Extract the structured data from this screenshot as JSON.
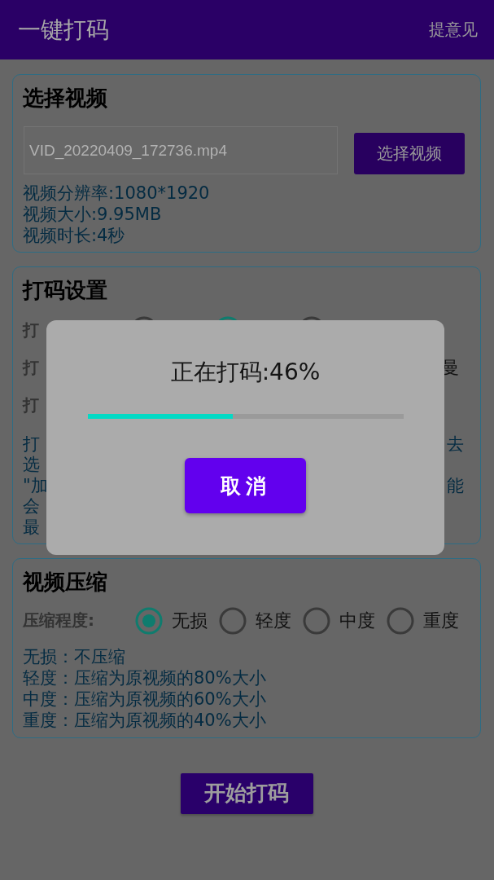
{
  "app_bar": {
    "title": "一键打码",
    "action": "提意见"
  },
  "video_card": {
    "title": "选择视频",
    "file_field": {
      "placeholder": "VID_20220409_172736.mp4"
    },
    "button": "选择视频",
    "info": [
      "视频分辨率:1080*1920",
      "视频大小:9.95MB",
      "视频时长:4秒"
    ]
  },
  "mosaic_card": {
    "title": "打码设置",
    "rows": [
      {
        "label": "打",
        "options": [
          {
            "selected": false
          },
          {
            "selected": true
          },
          {
            "selected": false
          }
        ]
      },
      {
        "label": "打",
        "end": "曼"
      },
      {
        "label": "打"
      }
    ],
    "notes": [
      {
        "start": "打",
        "end": "去"
      },
      {
        "start": "选"
      },
      {
        "start": "\"加",
        "end": "能"
      },
      {
        "start": "会"
      },
      {
        "start": "最"
      }
    ]
  },
  "compression_card": {
    "title": "视频压缩",
    "label": "压缩程度:",
    "options": [
      {
        "label": "无损",
        "selected": true
      },
      {
        "label": "轻度",
        "selected": false
      },
      {
        "label": "中度",
        "selected": false
      },
      {
        "label": "重度",
        "selected": false
      }
    ],
    "notes": [
      "无损：不压缩",
      "轻度：压缩为原视频的80%大小",
      "中度：压缩为原视频的60%大小",
      "重度：压缩为原视频的40%大小"
    ]
  },
  "start_button": "开始打码",
  "dialog": {
    "message": "正在打码:46%",
    "progress": {
      "level": 0.46
    },
    "button": "取消"
  }
}
